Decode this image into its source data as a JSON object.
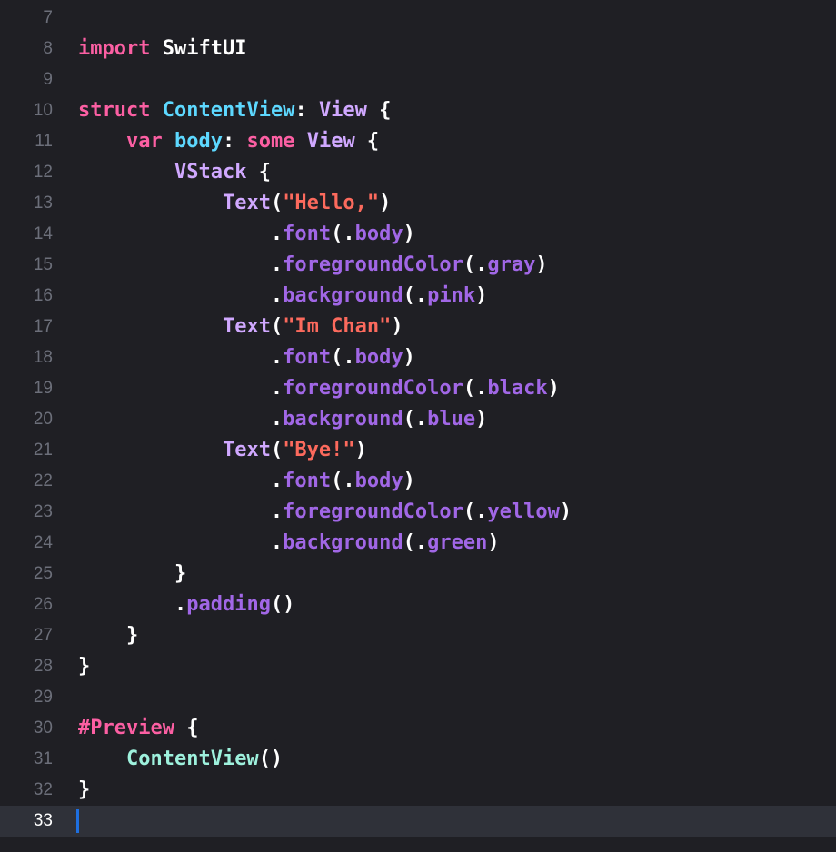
{
  "editor": {
    "current_line": 33,
    "colors": {
      "background": "#1f1f24",
      "current_line_bg": "#2f3139",
      "line_number": "#6c6f7a",
      "keyword": "#fc5fa3",
      "type": "#d0a8ff",
      "declared_type": "#5dd8ff",
      "project_type": "#9ef1dd",
      "method": "#a167e6",
      "string": "#fc6a5d",
      "plain": "#ffffff",
      "caret": "#1e6fe0"
    },
    "lines": [
      {
        "n": "7",
        "tokens": []
      },
      {
        "n": "8",
        "tokens": [
          {
            "t": "import",
            "k": "keyword"
          },
          {
            "t": " SwiftUI",
            "k": "plain"
          }
        ]
      },
      {
        "n": "9",
        "tokens": []
      },
      {
        "n": "10",
        "tokens": [
          {
            "t": "struct",
            "k": "keyword"
          },
          {
            "t": " ",
            "k": "plain"
          },
          {
            "t": "ContentView",
            "k": "declared_type"
          },
          {
            "t": ": ",
            "k": "plain"
          },
          {
            "t": "View",
            "k": "type"
          },
          {
            "t": " {",
            "k": "plain"
          }
        ]
      },
      {
        "n": "11",
        "tokens": [
          {
            "t": "    ",
            "k": "plain"
          },
          {
            "t": "var",
            "k": "keyword"
          },
          {
            "t": " ",
            "k": "plain"
          },
          {
            "t": "body",
            "k": "declared_type"
          },
          {
            "t": ": ",
            "k": "plain"
          },
          {
            "t": "some",
            "k": "keyword"
          },
          {
            "t": " ",
            "k": "plain"
          },
          {
            "t": "View",
            "k": "type"
          },
          {
            "t": " {",
            "k": "plain"
          }
        ]
      },
      {
        "n": "12",
        "tokens": [
          {
            "t": "        ",
            "k": "plain"
          },
          {
            "t": "VStack",
            "k": "type"
          },
          {
            "t": " {",
            "k": "plain"
          }
        ]
      },
      {
        "n": "13",
        "tokens": [
          {
            "t": "            ",
            "k": "plain"
          },
          {
            "t": "Text",
            "k": "type"
          },
          {
            "t": "(",
            "k": "plain"
          },
          {
            "t": "\"Hello,\"",
            "k": "string"
          },
          {
            "t": ")",
            "k": "plain"
          }
        ]
      },
      {
        "n": "14",
        "tokens": [
          {
            "t": "                .",
            "k": "plain"
          },
          {
            "t": "font",
            "k": "method"
          },
          {
            "t": "(.",
            "k": "plain"
          },
          {
            "t": "body",
            "k": "method"
          },
          {
            "t": ")",
            "k": "plain"
          }
        ]
      },
      {
        "n": "15",
        "tokens": [
          {
            "t": "                .",
            "k": "plain"
          },
          {
            "t": "foregroundColor",
            "k": "method"
          },
          {
            "t": "(.",
            "k": "plain"
          },
          {
            "t": "gray",
            "k": "method"
          },
          {
            "t": ")",
            "k": "plain"
          }
        ]
      },
      {
        "n": "16",
        "tokens": [
          {
            "t": "                .",
            "k": "plain"
          },
          {
            "t": "background",
            "k": "method"
          },
          {
            "t": "(.",
            "k": "plain"
          },
          {
            "t": "pink",
            "k": "method"
          },
          {
            "t": ")",
            "k": "plain"
          }
        ]
      },
      {
        "n": "17",
        "tokens": [
          {
            "t": "            ",
            "k": "plain"
          },
          {
            "t": "Text",
            "k": "type"
          },
          {
            "t": "(",
            "k": "plain"
          },
          {
            "t": "\"Im Chan\"",
            "k": "string"
          },
          {
            "t": ")",
            "k": "plain"
          }
        ]
      },
      {
        "n": "18",
        "tokens": [
          {
            "t": "                .",
            "k": "plain"
          },
          {
            "t": "font",
            "k": "method"
          },
          {
            "t": "(.",
            "k": "plain"
          },
          {
            "t": "body",
            "k": "method"
          },
          {
            "t": ")",
            "k": "plain"
          }
        ]
      },
      {
        "n": "19",
        "tokens": [
          {
            "t": "                .",
            "k": "plain"
          },
          {
            "t": "foregroundColor",
            "k": "method"
          },
          {
            "t": "(.",
            "k": "plain"
          },
          {
            "t": "black",
            "k": "method"
          },
          {
            "t": ")",
            "k": "plain"
          }
        ]
      },
      {
        "n": "20",
        "tokens": [
          {
            "t": "                .",
            "k": "plain"
          },
          {
            "t": "background",
            "k": "method"
          },
          {
            "t": "(.",
            "k": "plain"
          },
          {
            "t": "blue",
            "k": "method"
          },
          {
            "t": ")",
            "k": "plain"
          }
        ]
      },
      {
        "n": "21",
        "tokens": [
          {
            "t": "            ",
            "k": "plain"
          },
          {
            "t": "Text",
            "k": "type"
          },
          {
            "t": "(",
            "k": "plain"
          },
          {
            "t": "\"Bye!\"",
            "k": "string"
          },
          {
            "t": ")",
            "k": "plain"
          }
        ]
      },
      {
        "n": "22",
        "tokens": [
          {
            "t": "                .",
            "k": "plain"
          },
          {
            "t": "font",
            "k": "method"
          },
          {
            "t": "(.",
            "k": "plain"
          },
          {
            "t": "body",
            "k": "method"
          },
          {
            "t": ")",
            "k": "plain"
          }
        ]
      },
      {
        "n": "23",
        "tokens": [
          {
            "t": "                .",
            "k": "plain"
          },
          {
            "t": "foregroundColor",
            "k": "method"
          },
          {
            "t": "(.",
            "k": "plain"
          },
          {
            "t": "yellow",
            "k": "method"
          },
          {
            "t": ")",
            "k": "plain"
          }
        ]
      },
      {
        "n": "24",
        "tokens": [
          {
            "t": "                .",
            "k": "plain"
          },
          {
            "t": "background",
            "k": "method"
          },
          {
            "t": "(.",
            "k": "plain"
          },
          {
            "t": "green",
            "k": "method"
          },
          {
            "t": ")",
            "k": "plain"
          }
        ]
      },
      {
        "n": "25",
        "tokens": [
          {
            "t": "        }",
            "k": "plain"
          }
        ]
      },
      {
        "n": "26",
        "tokens": [
          {
            "t": "        .",
            "k": "plain"
          },
          {
            "t": "padding",
            "k": "method"
          },
          {
            "t": "()",
            "k": "plain"
          }
        ]
      },
      {
        "n": "27",
        "tokens": [
          {
            "t": "    }",
            "k": "plain"
          }
        ]
      },
      {
        "n": "28",
        "tokens": [
          {
            "t": "}",
            "k": "plain"
          }
        ]
      },
      {
        "n": "29",
        "tokens": []
      },
      {
        "n": "30",
        "tokens": [
          {
            "t": "#Preview",
            "k": "keyword"
          },
          {
            "t": " {",
            "k": "plain"
          }
        ]
      },
      {
        "n": "31",
        "tokens": [
          {
            "t": "    ",
            "k": "plain"
          },
          {
            "t": "ContentView",
            "k": "project_type"
          },
          {
            "t": "()",
            "k": "plain"
          }
        ]
      },
      {
        "n": "32",
        "tokens": [
          {
            "t": "}",
            "k": "plain"
          }
        ]
      },
      {
        "n": "33",
        "tokens": []
      }
    ]
  }
}
